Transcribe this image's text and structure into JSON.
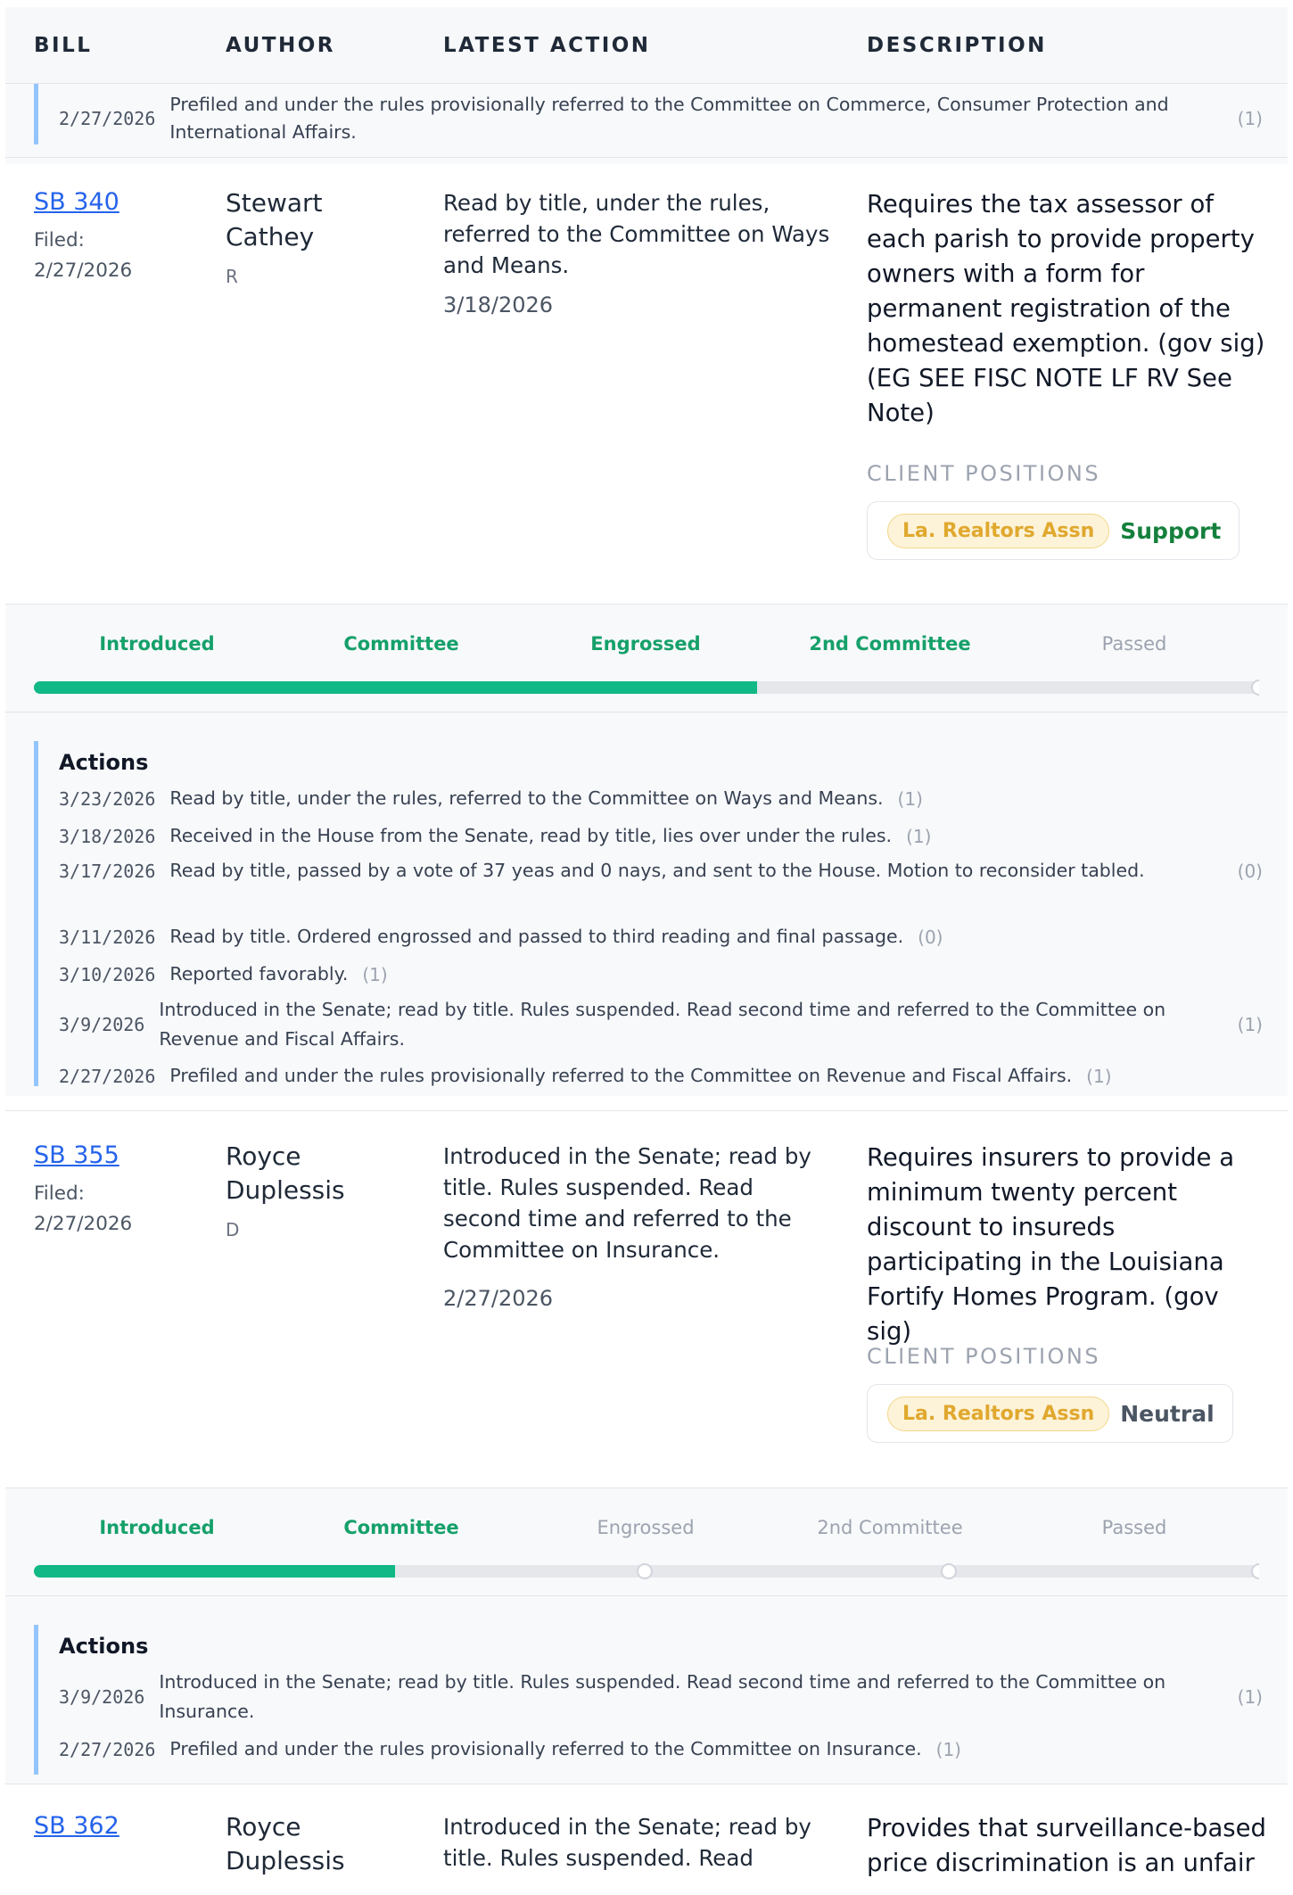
{
  "header": {
    "bill": "BILL",
    "author": "AUTHOR",
    "latest_action": "LATEST ACTION",
    "description": "DESCRIPTION"
  },
  "prev_bill_tail": {
    "action": {
      "date": "2/27/2026",
      "text": "Prefiled and under the rules provisionally referred to the Committee on Commerce, Consumer Protection and International Affairs.",
      "count": "(1)"
    }
  },
  "client_positions_label": "CLIENT POSITIONS",
  "actions_label": "Actions",
  "bills": [
    {
      "number": "SB 340",
      "filed_label": "Filed:",
      "filed_date": "2/27/2026",
      "author": "Stewart Cathey",
      "party": "R",
      "latest_action": "Read by title, under the rules, referred to the Committee on Ways and Means.",
      "latest_action_date": "3/18/2026",
      "description": "Requires the tax assessor of each parish to provide property owners with a form for permanent registration of the homestead exemption. (gov sig) (EG SEE FISC NOTE LF RV See Note)",
      "client": "La. Realtors Assn",
      "position": "Support",
      "position_color": "#15803d",
      "stages": [
        {
          "label": "Introduced",
          "done": true
        },
        {
          "label": "Committee",
          "done": true
        },
        {
          "label": "Engrossed",
          "done": true
        },
        {
          "label": "2nd Committee",
          "done": true
        },
        {
          "label": "Passed",
          "done": false
        }
      ],
      "progress_fraction": 0.59,
      "actions": [
        {
          "date": "3/23/2026",
          "text": "Read by title, under the rules, referred to the Committee on Ways and Means.",
          "count": "(1)"
        },
        {
          "date": "3/18/2026",
          "text": "Received in the House from the Senate, read by title, lies over under the rules.",
          "count": "(1)"
        },
        {
          "date": "3/17/2026",
          "text": "Read by title, passed by a vote of 37 yeas and 0 nays, and sent to the House. Motion to reconsider tabled.",
          "count": "(0)"
        },
        {
          "date": "3/11/2026",
          "text": "Read by title. Ordered engrossed and passed to third reading and final passage.",
          "count": "(0)"
        },
        {
          "date": "3/10/2026",
          "text": "Reported favorably.",
          "count": "(1)"
        },
        {
          "date": "3/9/2026",
          "text": "Introduced in the Senate; read by title. Rules suspended. Read second time and referred to the Committee on Revenue and Fiscal Affairs.",
          "count": "(1)"
        },
        {
          "date": "2/27/2026",
          "text": "Prefiled and under the rules provisionally referred to the Committee on Revenue and Fiscal Affairs.",
          "count": "(1)"
        }
      ]
    },
    {
      "number": "SB 355",
      "filed_label": "Filed:",
      "filed_date": "2/27/2026",
      "author": "Royce Duplessis",
      "party": "D",
      "latest_action": "Introduced in the Senate; read by title. Rules suspended. Read second time and referred to the Committee on Insurance.",
      "latest_action_date": "2/27/2026",
      "description": "Requires insurers to provide a minimum twenty percent discount to insureds participating in the Louisiana Fortify Homes Program. (gov sig)",
      "client": "La. Realtors Assn",
      "position": "Neutral",
      "position_color": "#4b5563",
      "stages": [
        {
          "label": "Introduced",
          "done": true
        },
        {
          "label": "Committee",
          "done": true
        },
        {
          "label": "Engrossed",
          "done": false
        },
        {
          "label": "2nd Committee",
          "done": false
        },
        {
          "label": "Passed",
          "done": false
        }
      ],
      "progress_fraction": 0.295,
      "actions": [
        {
          "date": "3/9/2026",
          "text": "Introduced in the Senate; read by title. Rules suspended. Read second time and referred to the Committee on Insurance.",
          "count": "(1)"
        },
        {
          "date": "2/27/2026",
          "text": "Prefiled and under the rules provisionally referred to the Committee on Insurance.",
          "count": "(1)"
        }
      ]
    },
    {
      "number": "SB 362",
      "author": "Royce Duplessis",
      "latest_action": "Introduced in the Senate; read by title. Rules suspended. Read",
      "description": "Provides that surveillance-based price discrimination is an unfair"
    }
  ]
}
